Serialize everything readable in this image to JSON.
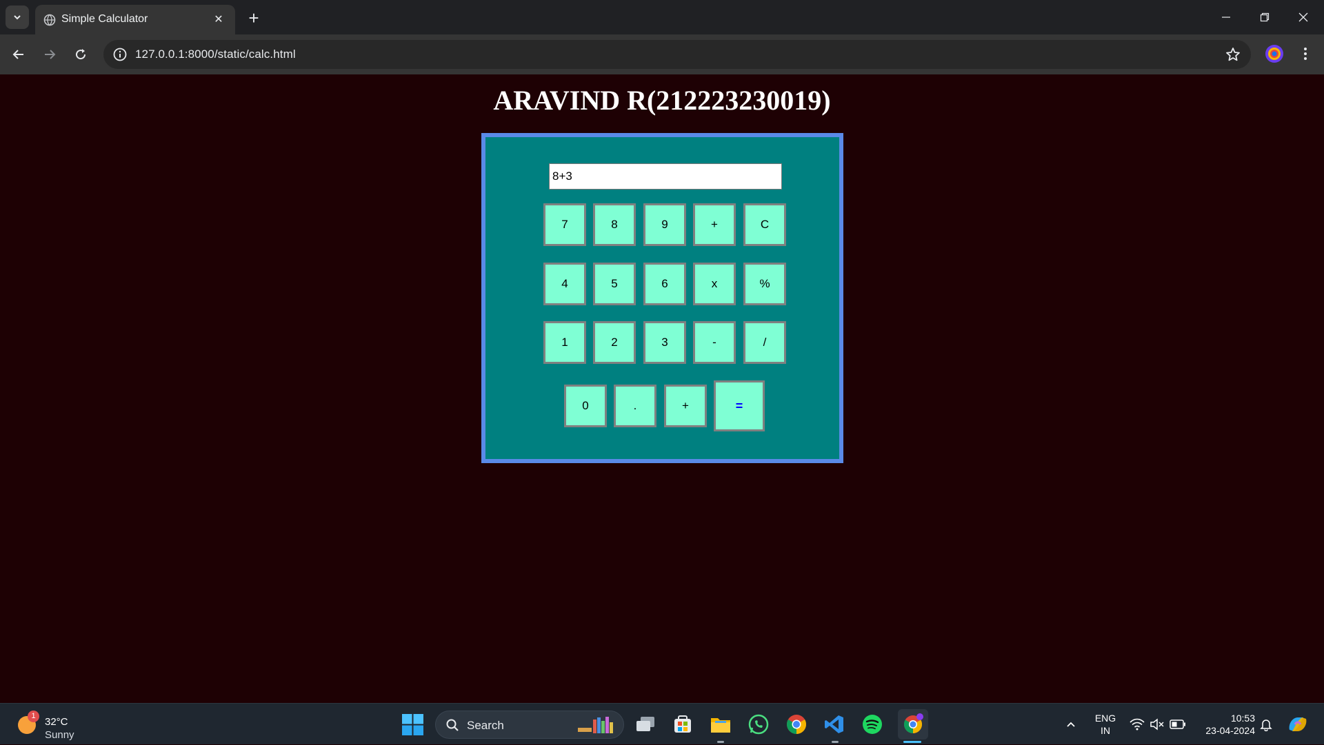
{
  "browser": {
    "tab_title": "Simple Calculator",
    "url": "127.0.0.1:8000/static/calc.html"
  },
  "page": {
    "heading": "ARAVIND R(212223230019)"
  },
  "calculator": {
    "display_value": "8+3",
    "rows": [
      [
        "7",
        "8",
        "9",
        "+",
        "C"
      ],
      [
        "4",
        "5",
        "6",
        "x",
        "%"
      ],
      [
        "1",
        "2",
        "3",
        "-",
        "/"
      ]
    ],
    "last_row": [
      "0",
      ".",
      "+"
    ],
    "equals": "="
  },
  "taskbar": {
    "weather_temp": "32°C",
    "weather_condition": "Sunny",
    "weather_badge": "1",
    "search_label": "Search",
    "lang_line1": "ENG",
    "lang_line2": "IN",
    "time": "10:53",
    "date": "23-04-2024"
  },
  "colors": {
    "page_bg": "#1e0104",
    "calc_bg": "#008080",
    "calc_border": "#5a8ae8",
    "key_bg": "#7fffd4",
    "equals_text": "#0000ff"
  }
}
